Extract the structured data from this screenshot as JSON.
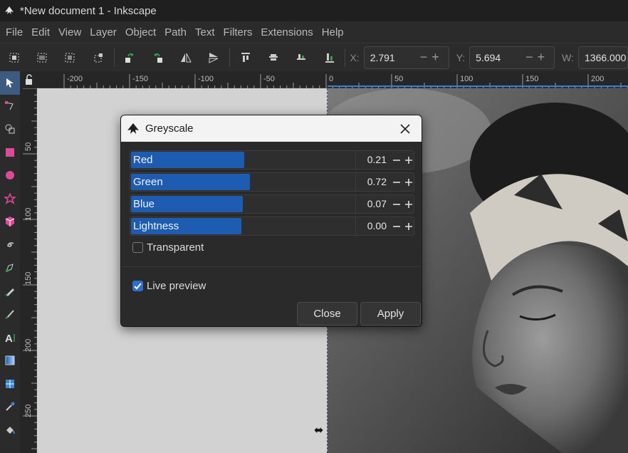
{
  "window": {
    "title": "*New document 1 - Inkscape"
  },
  "menubar": {
    "items": [
      "File",
      "Edit",
      "View",
      "Layer",
      "Object",
      "Path",
      "Text",
      "Filters",
      "Extensions",
      "Help"
    ]
  },
  "toolbar": {
    "x_label": "X:",
    "x_value": "2.791",
    "y_label": "Y:",
    "y_value": "5.694",
    "w_label": "W:",
    "w_value": "1366.000"
  },
  "rulers": {
    "horizontal": [
      "-200",
      "-150",
      "-100",
      "-50",
      "0",
      "50",
      "100",
      "150",
      "200"
    ],
    "vertical": [
      "50",
      "100",
      "150",
      "200",
      "250"
    ]
  },
  "dialog": {
    "title": "Greyscale",
    "sliders": [
      {
        "label": "Red",
        "value": "0.21",
        "fill": 0.4
      },
      {
        "label": "Green",
        "value": "0.72",
        "fill": 0.42
      },
      {
        "label": "Blue",
        "value": "0.07",
        "fill": 0.395
      },
      {
        "label": "Lightness",
        "value": "0.00",
        "fill": 0.39
      }
    ],
    "transparent_label": "Transparent",
    "transparent_checked": false,
    "live_preview_label": "Live preview",
    "live_preview_checked": true,
    "close_label": "Close",
    "apply_label": "Apply"
  },
  "colors": {
    "accent": "#1d5cb0",
    "checkbox": "#2d6fd0",
    "active_tool": "#3d5a80"
  }
}
